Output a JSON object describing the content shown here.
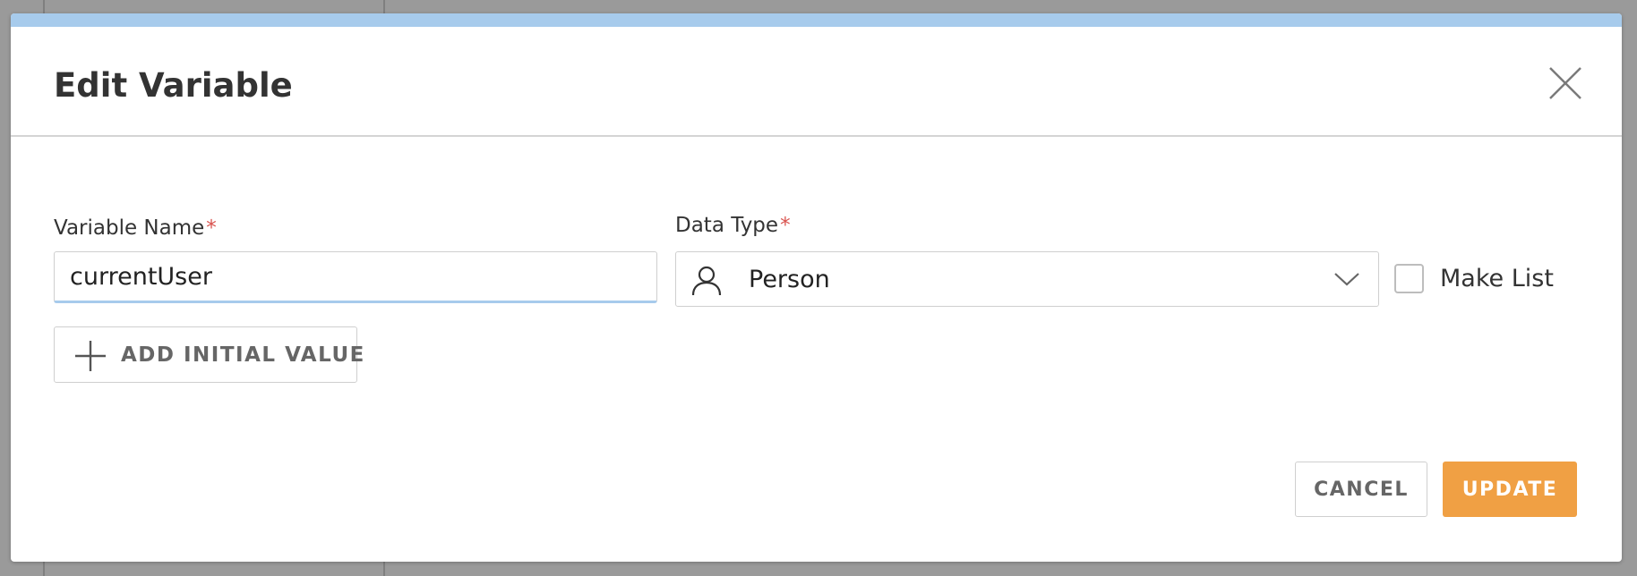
{
  "dialog": {
    "title": "Edit Variable",
    "accent_color": "#a7cbec",
    "close_icon": "close-icon"
  },
  "form": {
    "variable_name": {
      "label": "Variable Name",
      "required_marker": "*",
      "value": "currentUser"
    },
    "data_type": {
      "label": "Data Type",
      "required_marker": "*",
      "selected": "Person",
      "icon": "person-icon",
      "dropdown_icon": "chevron-down-icon"
    },
    "make_list": {
      "label": "Make List",
      "checked": false
    },
    "add_initial_value": {
      "label": "ADD INITIAL VALUE",
      "icon": "plus-icon"
    }
  },
  "footer": {
    "cancel_label": "CANCEL",
    "update_label": "UPDATE",
    "update_color": "#f0a044"
  }
}
